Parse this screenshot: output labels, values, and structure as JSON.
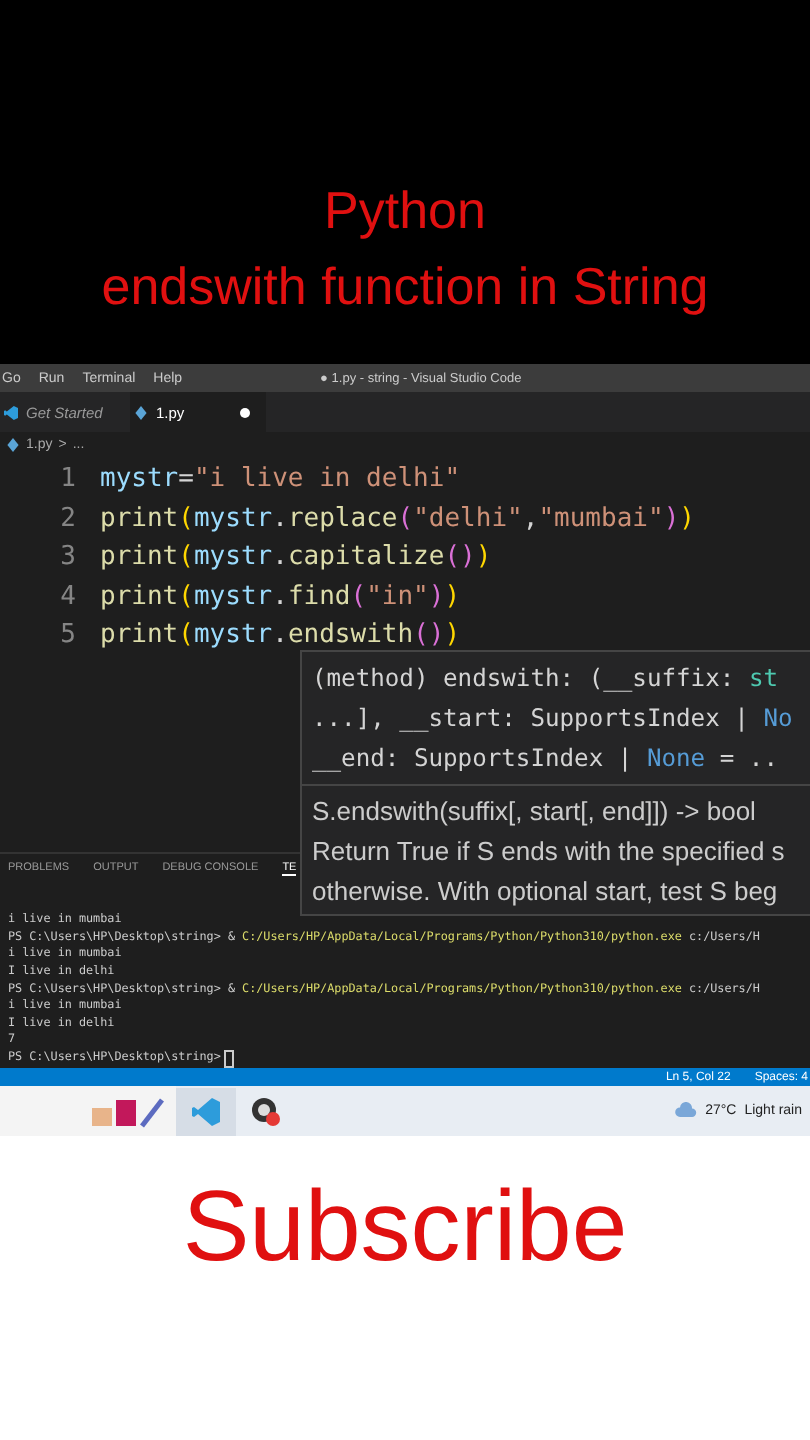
{
  "video_title": [
    "Python",
    "endswith function in String"
  ],
  "window": {
    "menu": [
      "Go",
      "Run",
      "Terminal",
      "Help"
    ],
    "title": "● 1.py - string - Visual Studio Code"
  },
  "tabs": [
    {
      "label": "Get Started",
      "selected": false,
      "kind": "welcome",
      "modified": false
    },
    {
      "label": "1.py",
      "selected": true,
      "kind": "python",
      "modified": true
    }
  ],
  "breadcrumb": [
    "1.py",
    ">",
    "..."
  ],
  "code": [
    {
      "number": "1",
      "tokens": [
        {
          "kind": "var",
          "text": "mystr"
        },
        {
          "kind": "plain",
          "text": "="
        },
        {
          "kind": "str",
          "text": "\"i live in delhi\""
        }
      ]
    },
    {
      "number": "2",
      "tokens": [
        {
          "kind": "fn",
          "text": "print"
        },
        {
          "kind": "paren",
          "text": "("
        },
        {
          "kind": "var",
          "text": "mystr"
        },
        {
          "kind": "plain",
          "text": "."
        },
        {
          "kind": "fn",
          "text": "replace"
        },
        {
          "kind": "paren2",
          "text": "("
        },
        {
          "kind": "str",
          "text": "\"delhi\""
        },
        {
          "kind": "plain",
          "text": ","
        },
        {
          "kind": "str",
          "text": "\"mumbai\""
        },
        {
          "kind": "paren2",
          "text": ")"
        },
        {
          "kind": "paren",
          "text": ")"
        }
      ]
    },
    {
      "number": "3",
      "tokens": [
        {
          "kind": "fn",
          "text": "print"
        },
        {
          "kind": "paren",
          "text": "("
        },
        {
          "kind": "var",
          "text": "mystr"
        },
        {
          "kind": "plain",
          "text": "."
        },
        {
          "kind": "fn",
          "text": "capitalize"
        },
        {
          "kind": "paren2",
          "text": "()"
        },
        {
          "kind": "paren",
          "text": ")"
        }
      ]
    },
    {
      "number": "4",
      "tokens": [
        {
          "kind": "fn",
          "text": "print"
        },
        {
          "kind": "paren",
          "text": "("
        },
        {
          "kind": "var",
          "text": "mystr"
        },
        {
          "kind": "plain",
          "text": "."
        },
        {
          "kind": "fn",
          "text": "find"
        },
        {
          "kind": "paren2",
          "text": "("
        },
        {
          "kind": "str",
          "text": "\"in\""
        },
        {
          "kind": "paren2",
          "text": ")"
        },
        {
          "kind": "paren",
          "text": ")"
        }
      ]
    },
    {
      "number": "5",
      "tokens": [
        {
          "kind": "fn",
          "text": "print"
        },
        {
          "kind": "paren",
          "text": "("
        },
        {
          "kind": "var",
          "text": "mystr"
        },
        {
          "kind": "plain",
          "text": "."
        },
        {
          "kind": "fn",
          "text": "endswith"
        },
        {
          "kind": "paren2",
          "text": "()"
        },
        {
          "kind": "paren",
          "text": ")"
        }
      ]
    }
  ],
  "hover": {
    "signature": [
      [
        {
          "kind": "plain",
          "text": "(method) endswith: (__suffix: "
        },
        {
          "kind": "type",
          "text": "st"
        }
      ],
      [
        {
          "kind": "plain",
          "text": "...], __start: SupportsIndex | "
        },
        {
          "kind": "kw",
          "text": "No"
        }
      ],
      [
        {
          "kind": "plain",
          "text": "__end: SupportsIndex | "
        },
        {
          "kind": "kw",
          "text": "None"
        },
        {
          "kind": "plain",
          "text": " = .."
        }
      ]
    ],
    "doc": [
      "S.endswith(suffix[, start[, end]]) -> bool",
      "Return True if S ends with the specified s",
      "otherwise. With optional start, test S beg"
    ]
  },
  "panel_tabs": [
    {
      "label": "PROBLEMS",
      "selected": false
    },
    {
      "label": "OUTPUT",
      "selected": false
    },
    {
      "label": "DEBUG CONSOLE",
      "selected": false
    },
    {
      "label": "TE",
      "selected": true
    }
  ],
  "terminal": [
    {
      "kind": "output",
      "text": "i live in mumbai"
    },
    {
      "kind": "command",
      "prompt": "PS C:\\Users\\HP\\Desktop\\string> &",
      "path": "C:/Users/HP/AppData/Local/Programs/Python/Python310/python.exe",
      "arg": "c:/Users/H"
    },
    {
      "kind": "output",
      "text": "i live in mumbai"
    },
    {
      "kind": "output",
      "text": "I live in delhi"
    },
    {
      "kind": "command",
      "prompt": "PS C:\\Users\\HP\\Desktop\\string> &",
      "path": "C:/Users/HP/AppData/Local/Programs/Python/Python310/python.exe",
      "arg": "c:/Users/H"
    },
    {
      "kind": "output",
      "text": "i live in mumbai"
    },
    {
      "kind": "output",
      "text": "I live in delhi"
    },
    {
      "kind": "output",
      "text": "7"
    },
    {
      "kind": "prompt",
      "text": "PS C:\\Users\\HP\\Desktop\\string>"
    }
  ],
  "status_bar": [
    "Ln 5, Col 22",
    "Spaces: 4"
  ],
  "taskbar": {
    "temperature": "27°C",
    "weather": "Light rain"
  },
  "call_to_action": "Subscribe"
}
